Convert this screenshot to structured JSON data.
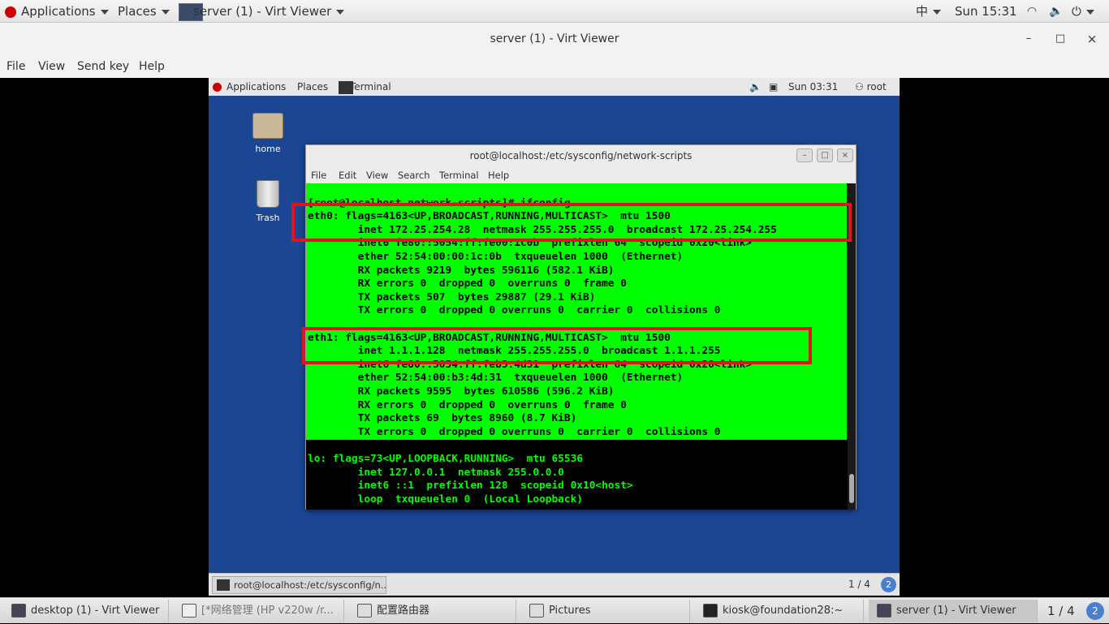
{
  "host_topbar": {
    "applications": "Applications",
    "places": "Places",
    "window_title": "server (1) - Virt Viewer",
    "input_method": "中",
    "clock": "Sun 15:31"
  },
  "viewer": {
    "title": "server (1) - Virt Viewer",
    "menu": [
      "File",
      "View",
      "Send key",
      "Help"
    ],
    "minimize_label": "–",
    "maximize_label": "□",
    "close_label": "×"
  },
  "guest": {
    "topbar": {
      "applications": "Applications",
      "places": "Places",
      "terminal": "Terminal",
      "clock": "Sun 03:31",
      "user": "root"
    },
    "desktop_icons": {
      "home": "home",
      "trash": "Trash"
    },
    "terminal": {
      "title": "root@localhost:/etc/sysconfig/network-scripts",
      "menu": [
        "File",
        "Edit",
        "View",
        "Search",
        "Terminal",
        "Help"
      ],
      "lines": [
        "[root@localhost network-scripts]#",
        "[root@localhost network-scripts]# ifconfig",
        "eth0: flags=4163<UP,BROADCAST,RUNNING,MULTICAST>  mtu 1500",
        "        inet 172.25.254.28  netmask 255.255.255.0  broadcast 172.25.254.255",
        "        inet6 fe80::5054:ff:fe00:1c0b  prefixlen 64  scopeid 0x20<link>",
        "        ether 52:54:00:00:1c:0b  txqueuelen 1000  (Ethernet)",
        "        RX packets 9219  bytes 596116 (582.1 KiB)",
        "        RX errors 0  dropped 0  overruns 0  frame 0",
        "        TX packets 507  bytes 29887 (29.1 KiB)",
        "        TX errors 0  dropped 0 overruns 0  carrier 0  collisions 0",
        "",
        "eth1: flags=4163<UP,BROADCAST,RUNNING,MULTICAST>  mtu 1500",
        "        inet 1.1.1.128  netmask 255.255.255.0  broadcast 1.1.1.255",
        "        inet6 fe80::5054:ff:feb3:4d31  prefixlen 64  scopeid 0x20<link>",
        "        ether 52:54:00:b3:4d:31  txqueuelen 1000  (Ethernet)",
        "        RX packets 9595  bytes 610586 (596.2 KiB)",
        "        RX errors 0  dropped 0  overruns 0  frame 0",
        "        TX packets 69  bytes 8960 (8.7 KiB)",
        "        TX errors 0  dropped 0 overruns 0  carrier 0  collisions 0",
        "",
        "lo: flags=73<UP,LOOPBACK,RUNNING>  mtu 65536",
        "        inet 127.0.0.1  netmask 255.0.0.0",
        "        inet6 ::1  prefixlen 128  scopeid 0x10<host>",
        "        loop  txqueuelen 0  (Local Loopback)"
      ]
    },
    "bottom": {
      "task": "root@localhost:/etc/sysconfig/n...",
      "pager": "1 / 4"
    }
  },
  "host_taskbar": {
    "tasks": [
      "desktop (1) - Virt Viewer",
      "[*网络管理 (HP v220w /r...",
      "配置路由器",
      "Pictures",
      "kiosk@foundation28:~",
      "server (1) - Virt Viewer"
    ],
    "pager": "1 / 4"
  },
  "colors": {
    "terminal_highlight": "#00ff00",
    "annotation_box": "#e0141e",
    "guest_desktop": "#1a4694"
  }
}
